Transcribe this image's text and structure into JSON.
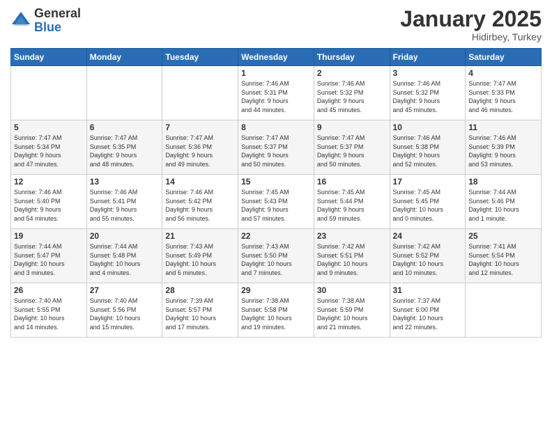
{
  "logo": {
    "general": "General",
    "blue": "Blue"
  },
  "title": "January 2025",
  "location": "Hidirbey, Turkey",
  "weekdays": [
    "Sunday",
    "Monday",
    "Tuesday",
    "Wednesday",
    "Thursday",
    "Friday",
    "Saturday"
  ],
  "weeks": [
    [
      {
        "day": "",
        "info": ""
      },
      {
        "day": "",
        "info": ""
      },
      {
        "day": "",
        "info": ""
      },
      {
        "day": "1",
        "info": "Sunrise: 7:46 AM\nSunset: 5:31 PM\nDaylight: 9 hours\nand 44 minutes."
      },
      {
        "day": "2",
        "info": "Sunrise: 7:46 AM\nSunset: 5:32 PM\nDaylight: 9 hours\nand 45 minutes."
      },
      {
        "day": "3",
        "info": "Sunrise: 7:46 AM\nSunset: 5:32 PM\nDaylight: 9 hours\nand 45 minutes."
      },
      {
        "day": "4",
        "info": "Sunrise: 7:47 AM\nSunset: 5:33 PM\nDaylight: 9 hours\nand 46 minutes."
      }
    ],
    [
      {
        "day": "5",
        "info": "Sunrise: 7:47 AM\nSunset: 5:34 PM\nDaylight: 9 hours\nand 47 minutes."
      },
      {
        "day": "6",
        "info": "Sunrise: 7:47 AM\nSunset: 5:35 PM\nDaylight: 9 hours\nand 48 minutes."
      },
      {
        "day": "7",
        "info": "Sunrise: 7:47 AM\nSunset: 5:36 PM\nDaylight: 9 hours\nand 49 minutes."
      },
      {
        "day": "8",
        "info": "Sunrise: 7:47 AM\nSunset: 5:37 PM\nDaylight: 9 hours\nand 50 minutes."
      },
      {
        "day": "9",
        "info": "Sunrise: 7:47 AM\nSunset: 5:37 PM\nDaylight: 9 hours\nand 50 minutes."
      },
      {
        "day": "10",
        "info": "Sunrise: 7:46 AM\nSunset: 5:38 PM\nDaylight: 9 hours\nand 52 minutes."
      },
      {
        "day": "11",
        "info": "Sunrise: 7:46 AM\nSunset: 5:39 PM\nDaylight: 9 hours\nand 53 minutes."
      }
    ],
    [
      {
        "day": "12",
        "info": "Sunrise: 7:46 AM\nSunset: 5:40 PM\nDaylight: 9 hours\nand 54 minutes."
      },
      {
        "day": "13",
        "info": "Sunrise: 7:46 AM\nSunset: 5:41 PM\nDaylight: 9 hours\nand 55 minutes."
      },
      {
        "day": "14",
        "info": "Sunrise: 7:46 AM\nSunset: 5:42 PM\nDaylight: 9 hours\nand 56 minutes."
      },
      {
        "day": "15",
        "info": "Sunrise: 7:45 AM\nSunset: 5:43 PM\nDaylight: 9 hours\nand 57 minutes."
      },
      {
        "day": "16",
        "info": "Sunrise: 7:45 AM\nSunset: 5:44 PM\nDaylight: 9 hours\nand 59 minutes."
      },
      {
        "day": "17",
        "info": "Sunrise: 7:45 AM\nSunset: 5:45 PM\nDaylight: 10 hours\nand 0 minutes."
      },
      {
        "day": "18",
        "info": "Sunrise: 7:44 AM\nSunset: 5:46 PM\nDaylight: 10 hours\nand 1 minute."
      }
    ],
    [
      {
        "day": "19",
        "info": "Sunrise: 7:44 AM\nSunset: 5:47 PM\nDaylight: 10 hours\nand 3 minutes."
      },
      {
        "day": "20",
        "info": "Sunrise: 7:44 AM\nSunset: 5:48 PM\nDaylight: 10 hours\nand 4 minutes."
      },
      {
        "day": "21",
        "info": "Sunrise: 7:43 AM\nSunset: 5:49 PM\nDaylight: 10 hours\nand 6 minutes."
      },
      {
        "day": "22",
        "info": "Sunrise: 7:43 AM\nSunset: 5:50 PM\nDaylight: 10 hours\nand 7 minutes."
      },
      {
        "day": "23",
        "info": "Sunrise: 7:42 AM\nSunset: 5:51 PM\nDaylight: 10 hours\nand 9 minutes."
      },
      {
        "day": "24",
        "info": "Sunrise: 7:42 AM\nSunset: 5:52 PM\nDaylight: 10 hours\nand 10 minutes."
      },
      {
        "day": "25",
        "info": "Sunrise: 7:41 AM\nSunset: 5:54 PM\nDaylight: 10 hours\nand 12 minutes."
      }
    ],
    [
      {
        "day": "26",
        "info": "Sunrise: 7:40 AM\nSunset: 5:55 PM\nDaylight: 10 hours\nand 14 minutes."
      },
      {
        "day": "27",
        "info": "Sunrise: 7:40 AM\nSunset: 5:56 PM\nDaylight: 10 hours\nand 15 minutes."
      },
      {
        "day": "28",
        "info": "Sunrise: 7:39 AM\nSunset: 5:57 PM\nDaylight: 10 hours\nand 17 minutes."
      },
      {
        "day": "29",
        "info": "Sunrise: 7:38 AM\nSunset: 5:58 PM\nDaylight: 10 hours\nand 19 minutes."
      },
      {
        "day": "30",
        "info": "Sunrise: 7:38 AM\nSunset: 5:59 PM\nDaylight: 10 hours\nand 21 minutes."
      },
      {
        "day": "31",
        "info": "Sunrise: 7:37 AM\nSunset: 6:00 PM\nDaylight: 10 hours\nand 22 minutes."
      },
      {
        "day": "",
        "info": ""
      }
    ]
  ]
}
